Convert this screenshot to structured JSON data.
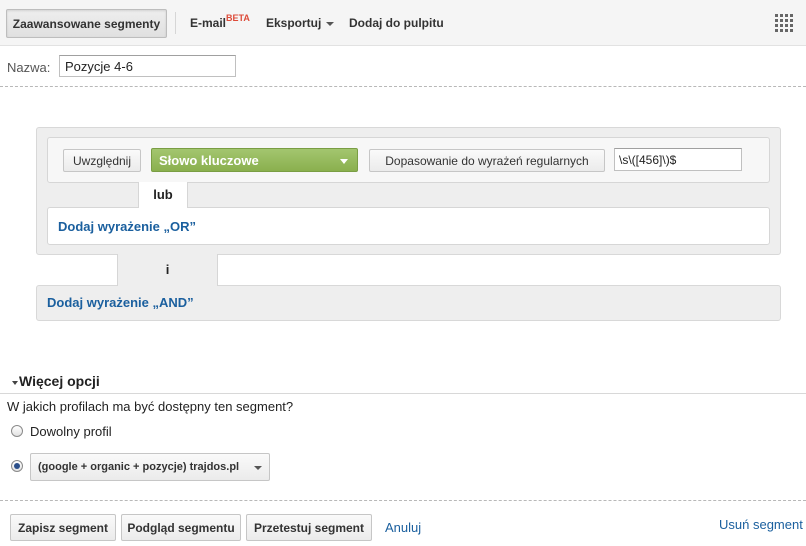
{
  "toolbar": {
    "advanced_segments": "Zaawansowane segmenty",
    "email": "E-mail",
    "beta": "BETA",
    "export": "Eksportuj",
    "add_to_dashboard": "Dodaj do pulpitu",
    "apps_icon": "grid-icon"
  },
  "name": {
    "label": "Nazwa:",
    "value": "Pozycje 4-6"
  },
  "condition": {
    "include_label": "Uwzględnij",
    "dimension": "Słowo kluczowe",
    "match_type": "Dopasowanie do wyrażeń regularnych",
    "value": "\\s\\([456]\\)$",
    "dimension_color": "#97bb5e"
  },
  "builder": {
    "or_connector": "lub",
    "add_or": "Dodaj wyrażenie „OR”",
    "and_connector": "i",
    "add_and": "Dodaj wyrażenie „AND”"
  },
  "more_options": {
    "title": "Więcej opcji",
    "question": "W jakich profilach ma być dostępny ten segment?",
    "option_any": "Dowolny profil",
    "option_profile": "(google + organic + pozycje) trajdos.pl",
    "selected": "option_profile"
  },
  "actions": {
    "save": "Zapisz segment",
    "preview": "Podgląd segmentu",
    "test": "Przetestuj segment",
    "cancel": "Anuluj",
    "delete": "Usuń segment"
  }
}
